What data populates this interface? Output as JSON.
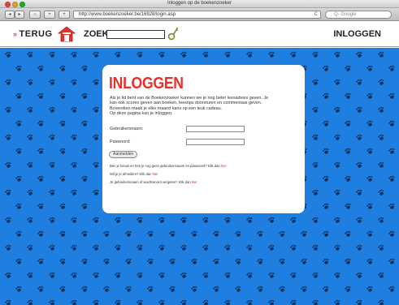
{
  "window": {
    "title": "Inloggen op de boekenzoeker"
  },
  "browser": {
    "url": "http://www.boekenzoeker.be/16928/login.asp",
    "reload_label": "C",
    "search_placeholder": "Q- Google",
    "back_label": "◂",
    "forward_label": "▸",
    "home_label": "⌂",
    "add_label": "+"
  },
  "header": {
    "back_arrows": "»",
    "back_label": "TERUG",
    "zoek_label": "ZOEK",
    "zoek_value": "",
    "login_label": "INLOGGEN"
  },
  "colors": {
    "accent": "#e8302a",
    "pattern_bg": "#1e7fe0",
    "card_bg": "#ffffff"
  },
  "login": {
    "title": "INLOGGEN",
    "intro_1": "Als je lid bent van de Boekenzoeker kunnen we je nog beter leesadvies geven. Je",
    "intro_2": "kan ook scores geven aan boeken, leestips doorsturen en commentaar geven.",
    "intro_3": "Bovendien maak je elke maand kans op een leuk cadeau.",
    "intro_4": "Op deze pagina kan je inloggen.",
    "username_label": "Gebruikersnaam:",
    "username_value": "",
    "password_label": "Paswoord:",
    "password_value": "",
    "submit_label": "Aanmelden",
    "help_1_text": "Ben je nieuw en heb je nog geen gebruikersnaam en paswoord? Klik dan ",
    "help_1_link": "hier",
    "help_2_text": "Wil je je afmelden? Klik dan ",
    "help_2_link": "hier",
    "help_3_text": "Je gebruikersnaam of wachtwoord vergeten? Klik dan ",
    "help_3_link": "hier"
  }
}
